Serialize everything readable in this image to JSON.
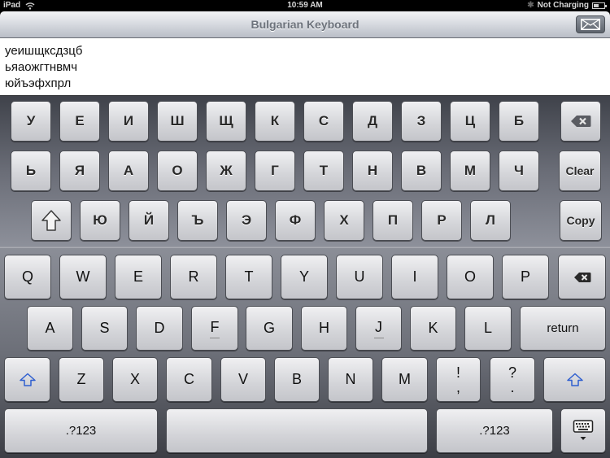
{
  "status_bar": {
    "device": "iPad",
    "time": "10:59 AM",
    "charging": "Not Charging",
    "icons": [
      "wifi-icon",
      "bluetooth-icon",
      "battery-icon"
    ]
  },
  "nav": {
    "title": "Bulgarian Keyboard",
    "mail_button_icon": "envelope-icon"
  },
  "text_area": {
    "lines": [
      "уеишщксдзцб",
      "ьяаожгтнвмч",
      "юйъэфхпрл"
    ]
  },
  "custom_keyboard": {
    "row1": [
      "У",
      "Е",
      "И",
      "Ш",
      "Щ",
      "К",
      "С",
      "Д",
      "З",
      "Ц",
      "Б"
    ],
    "row2": [
      "Ь",
      "Я",
      "А",
      "О",
      "Ж",
      "Г",
      "Т",
      "Н",
      "В",
      "М",
      "Ч"
    ],
    "row3": [
      "Ю",
      "Й",
      "Ъ",
      "Э",
      "Ф",
      "Х",
      "П",
      "Р",
      "Л"
    ],
    "delete_icon": "delete-icon",
    "shift_icon": "shift-icon",
    "clear_label": "Clear",
    "copy_label": "Copy"
  },
  "system_keyboard": {
    "row1": [
      "Q",
      "W",
      "E",
      "R",
      "T",
      "Y",
      "U",
      "I",
      "O",
      "P"
    ],
    "row2": [
      "A",
      "S",
      "D",
      "F",
      "G",
      "H",
      "J",
      "K",
      "L"
    ],
    "row3": [
      "Z",
      "X",
      "C",
      "V",
      "B",
      "N",
      "M"
    ],
    "punct1_top": "!",
    "punct1_bottom": ",",
    "punct2_top": "?",
    "punct2_bottom": ".",
    "return_label": "return",
    "numbers_label": ".?123",
    "space_label": "",
    "accent_color": "#2f5fd0"
  }
}
